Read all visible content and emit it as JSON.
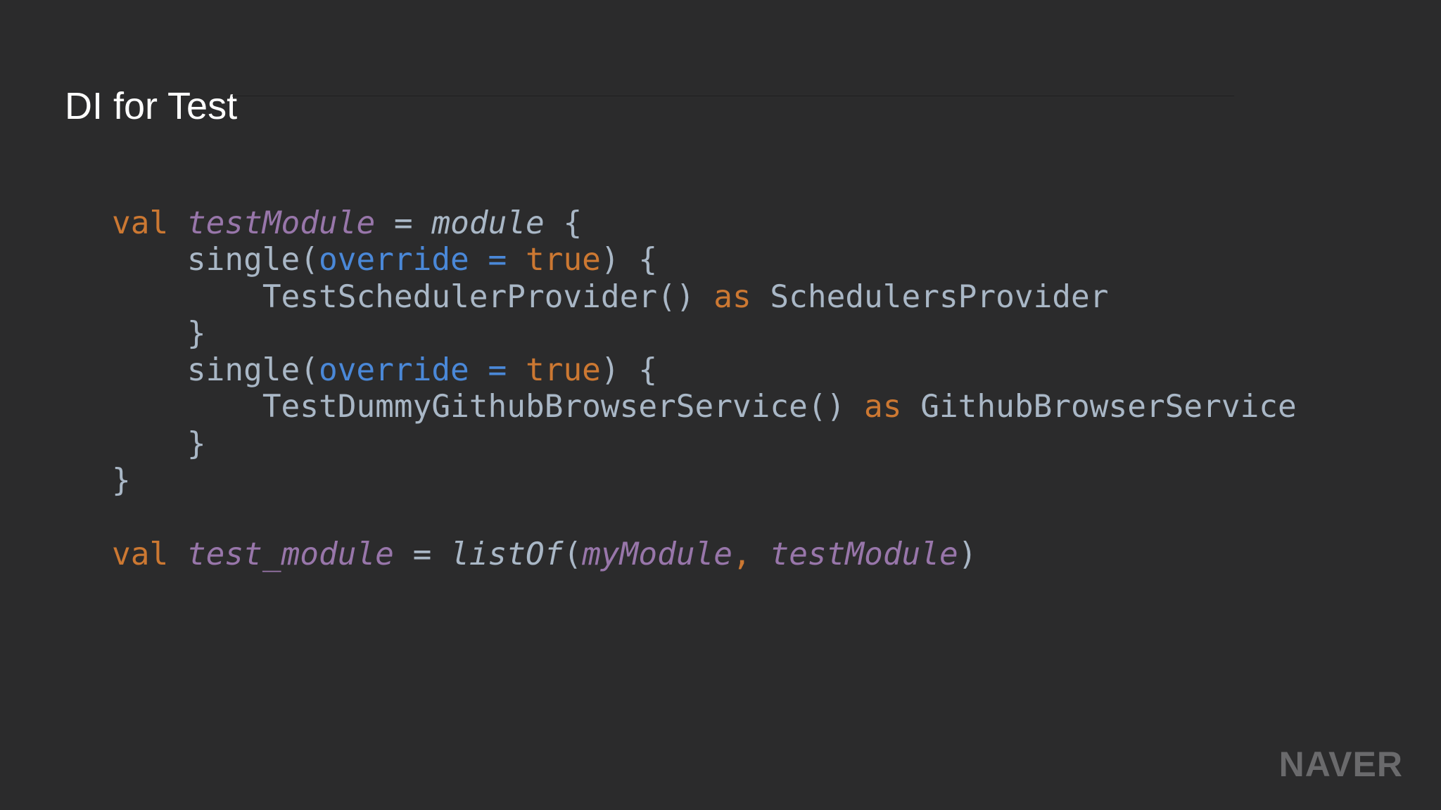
{
  "slide": {
    "title": "DI for Test"
  },
  "code": {
    "l1": {
      "kw_val": "val",
      "var_name": "testModule",
      "eq": "=",
      "fn_name": "module",
      "brace": "{"
    },
    "l2": {
      "indent": "    ",
      "fn": "single(",
      "param": "override",
      "eq": "=",
      "value": "true",
      "close": ") {"
    },
    "l3": {
      "indent": "        ",
      "expr": "TestSchedulerProvider()",
      "kw_as": "as",
      "type": "SchedulersProvider"
    },
    "l4": {
      "text": "    }"
    },
    "l5": {
      "indent": "    ",
      "fn": "single(",
      "param": "override",
      "eq": "=",
      "value": "true",
      "close": ") {"
    },
    "l6": {
      "indent": "        ",
      "expr": "TestDummyGithubBrowserService()",
      "kw_as": "as",
      "type": "GithubBrowserService"
    },
    "l7": {
      "text": "    }"
    },
    "l8": {
      "text": "}"
    },
    "l10": {
      "kw_val": "val",
      "var_name": "test_module",
      "eq": "=",
      "fn_name": "listOf",
      "open": "(",
      "arg1": "myModule",
      "comma": ",",
      "arg2": "testModule",
      "close": ")"
    }
  },
  "brand": {
    "logo": "NAVER"
  },
  "colors": {
    "background": "#2b2b2c",
    "keyword": "#cc7832",
    "variable": "#9876aa",
    "parameter": "#4a88d8",
    "text": "#a9b7c6"
  }
}
